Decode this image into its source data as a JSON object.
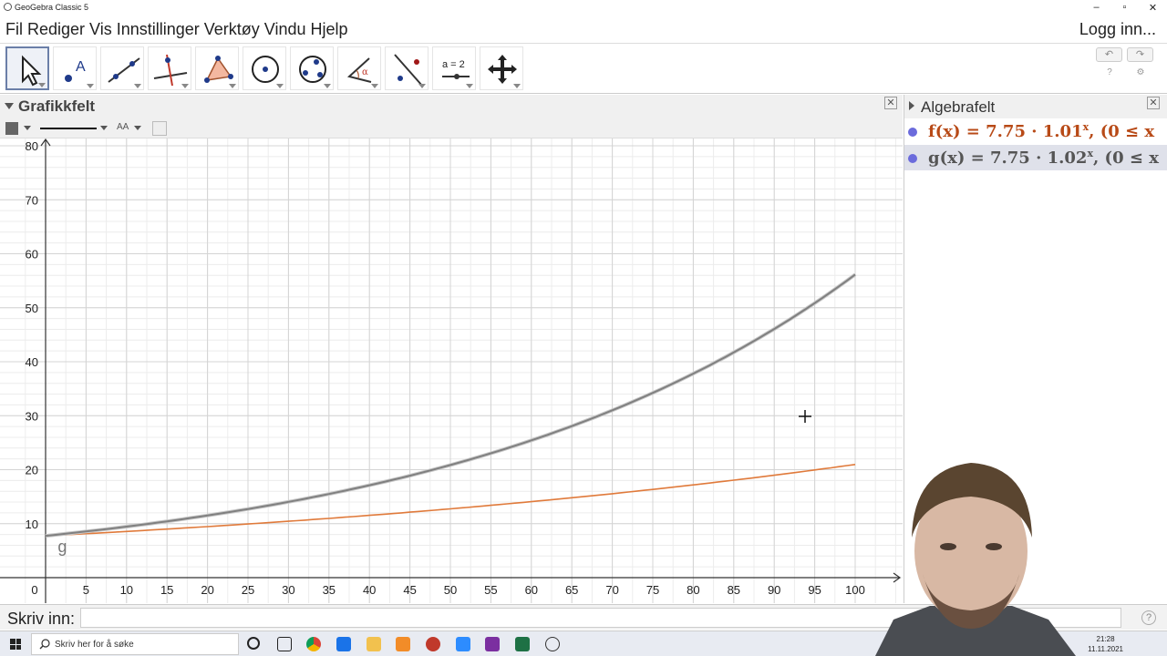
{
  "window": {
    "title": "GeoGebra Classic 5",
    "min": "–",
    "restore": "▫",
    "close": "✕"
  },
  "menu": {
    "items": [
      "Fil",
      "Rediger",
      "Vis",
      "Innstillinger",
      "Verktøy",
      "Vindu",
      "Hjelp"
    ],
    "login": "Logg inn..."
  },
  "toolbar": {
    "tools": [
      "move-tool",
      "point-tool",
      "line-tool",
      "perpendicular-tool",
      "polygon-tool",
      "circle-center-tool",
      "circle-3points-tool",
      "angle-tool",
      "reflect-tool",
      "slider-tool",
      "move-graphics-tool"
    ],
    "slider_label": "a = 2",
    "undo": "↶",
    "redo": "↷",
    "help": "?",
    "settings": "⚙"
  },
  "graphics": {
    "title": "Grafikkfelt",
    "close": "✕",
    "stylebar_aa": "AA"
  },
  "algebra": {
    "title": "Algebrafelt",
    "close": "✕",
    "rows": [
      {
        "name": "f",
        "prefix": "f(x) = 7.75 · 1.01",
        "exp": "x",
        "suffix": ",    (0 ≤ x",
        "color": "#b84a17"
      },
      {
        "name": "g",
        "prefix": "g(x) = 7.75 · 1.02",
        "exp": "x",
        "suffix": ",    (0 ≤ x",
        "color": "#555555"
      }
    ]
  },
  "input": {
    "label": "Skriv inn:",
    "value": "",
    "help": "?"
  },
  "taskbar": {
    "search_placeholder": "Skriv her for å søke",
    "time": "21:28",
    "date": "11.11.2021"
  },
  "chart_data": {
    "type": "line",
    "xlim": [
      0,
      100
    ],
    "ylim": [
      0,
      80
    ],
    "x_ticks": [
      0,
      5,
      10,
      15,
      20,
      25,
      30,
      35,
      40,
      45,
      50,
      55,
      60,
      65,
      70,
      75,
      80,
      85,
      90,
      95,
      100
    ],
    "y_ticks": [
      10,
      20,
      30,
      40,
      50,
      60,
      70,
      80
    ],
    "grid": true,
    "series": [
      {
        "name": "f",
        "color": "#e07a3b",
        "base": 7.75,
        "growth": 1.01,
        "domain": [
          0,
          100
        ]
      },
      {
        "name": "g",
        "color": "#808080",
        "base": 7.75,
        "growth": 1.02,
        "domain": [
          0,
          100
        ]
      }
    ],
    "annotations": [
      "g"
    ]
  }
}
